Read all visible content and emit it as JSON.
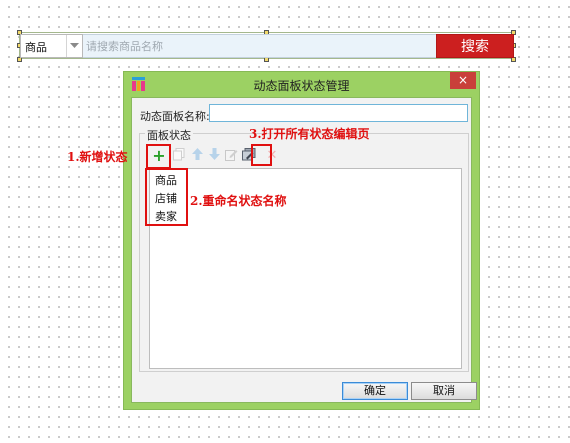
{
  "search": {
    "category": "商品",
    "placeholder": "请搜索商品名称",
    "button": "搜索"
  },
  "dialog": {
    "title": "动态面板状态管理",
    "close": "×",
    "name_label": "动态面板名称:",
    "name_value": "",
    "group_label": "面板状态",
    "toolbar": [
      "add-icon",
      "duplicate-icon",
      "move-up-icon",
      "move-down-icon",
      "edit-icon",
      "edit-all-icon",
      "delete-icon"
    ],
    "states": [
      "商品",
      "店铺",
      "卖家"
    ],
    "ok": "确定",
    "cancel": "取消"
  },
  "annotations": {
    "add_state": "1.新增状态",
    "rename_state": "2.重命名状态名称",
    "open_all": "3.打开所有状态编辑页"
  },
  "colors": {
    "dialog_frame": "#9cd163",
    "close_button": "#c9403a",
    "search_button": "#cc1f1f",
    "annotation": "#e01010"
  }
}
